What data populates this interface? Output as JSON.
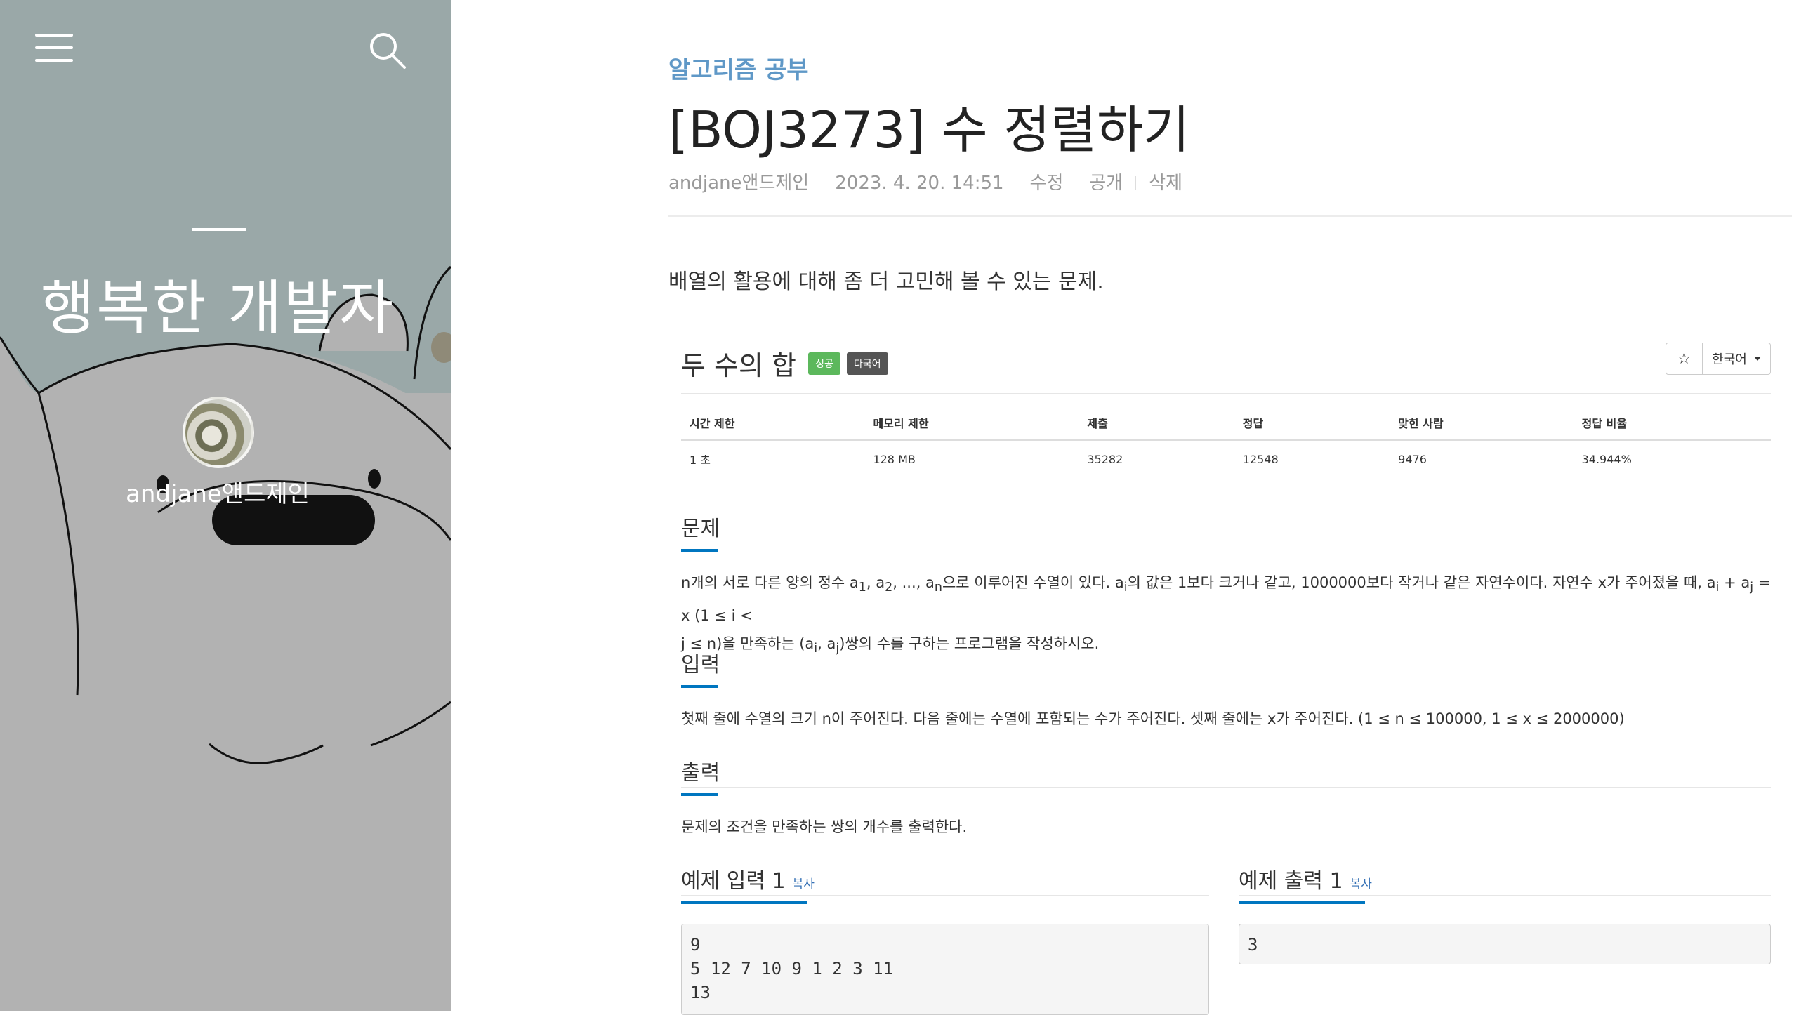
{
  "sidebar": {
    "blog_title": "행복한 개발자",
    "author": "andjane앤드제인",
    "menu_icon": "hamburger-icon",
    "search_icon": "search-icon",
    "bg_sky": "#9aa8a8",
    "bg_bear": "#b2b2b2"
  },
  "post": {
    "category": "알고리즘 공부",
    "title": "[BOJ3273] 수 정렬하기",
    "meta": {
      "author": "andjane앤드제인",
      "date": "2023. 4. 20. 14:51",
      "edit": "수정",
      "visibility": "공개",
      "delete": "삭제"
    },
    "intro": "배열의 활용에 대해 좀 더 고민해 볼 수 있는 문제."
  },
  "problem": {
    "name": "두 수의 합",
    "badge_success": "성공",
    "badge_lang": "다국어",
    "star": "☆",
    "language": "한국어",
    "table": {
      "headers": [
        "시간 제한",
        "메모리 제한",
        "제출",
        "정답",
        "맞힌 사람",
        "정답 비율"
      ],
      "values": [
        "1 초",
        "128 MB",
        "35282",
        "12548",
        "9476",
        "34.944%"
      ]
    },
    "desc_title": "문제",
    "desc_line1_a": "n개의 서로 다른 양의 정수 a",
    "desc_line1_b": "1",
    "desc_line1_c": ", a",
    "desc_line1_d": "2",
    "desc_line1_e": ", ..., a",
    "desc_line1_f": "n",
    "desc_line1_g": "으로 이루어진 수열이 있다. a",
    "desc_line1_h": "i",
    "desc_line1_i": "의 값은 1보다 크거나 같고, 1000000보다 작거나 같은 자연수이다. 자연수 x가 주어졌을 때, a",
    "desc_line1_j": "i",
    "desc_line1_k": " + a",
    "desc_line1_l": "j",
    "desc_line1_m": " = x (1 ≤ i <",
    "desc_line2_a": "j ≤ n)을 만족하는 (a",
    "desc_line2_b": "i",
    "desc_line2_c": ", a",
    "desc_line2_d": "j",
    "desc_line2_e": ")쌍의 수를 구하는 프로그램을 작성하시오.",
    "input_title": "입력",
    "input_text": "첫째 줄에 수열의 크기 n이 주어진다. 다음 줄에는 수열에 포함되는 수가 주어진다. 셋째 줄에는 x가 주어진다. (1 ≤ n ≤ 100000, 1 ≤ x ≤ 2000000)",
    "output_title": "출력",
    "output_text": "문제의 조건을 만족하는 쌍의 개수를 출력한다.",
    "sample_in_title": "예제 입력 1",
    "sample_out_title": "예제 출력 1",
    "copy_label": "복사",
    "sample_in": "9\n5 12 7 10 9 1 2 3 11\n13",
    "sample_out": "3"
  }
}
